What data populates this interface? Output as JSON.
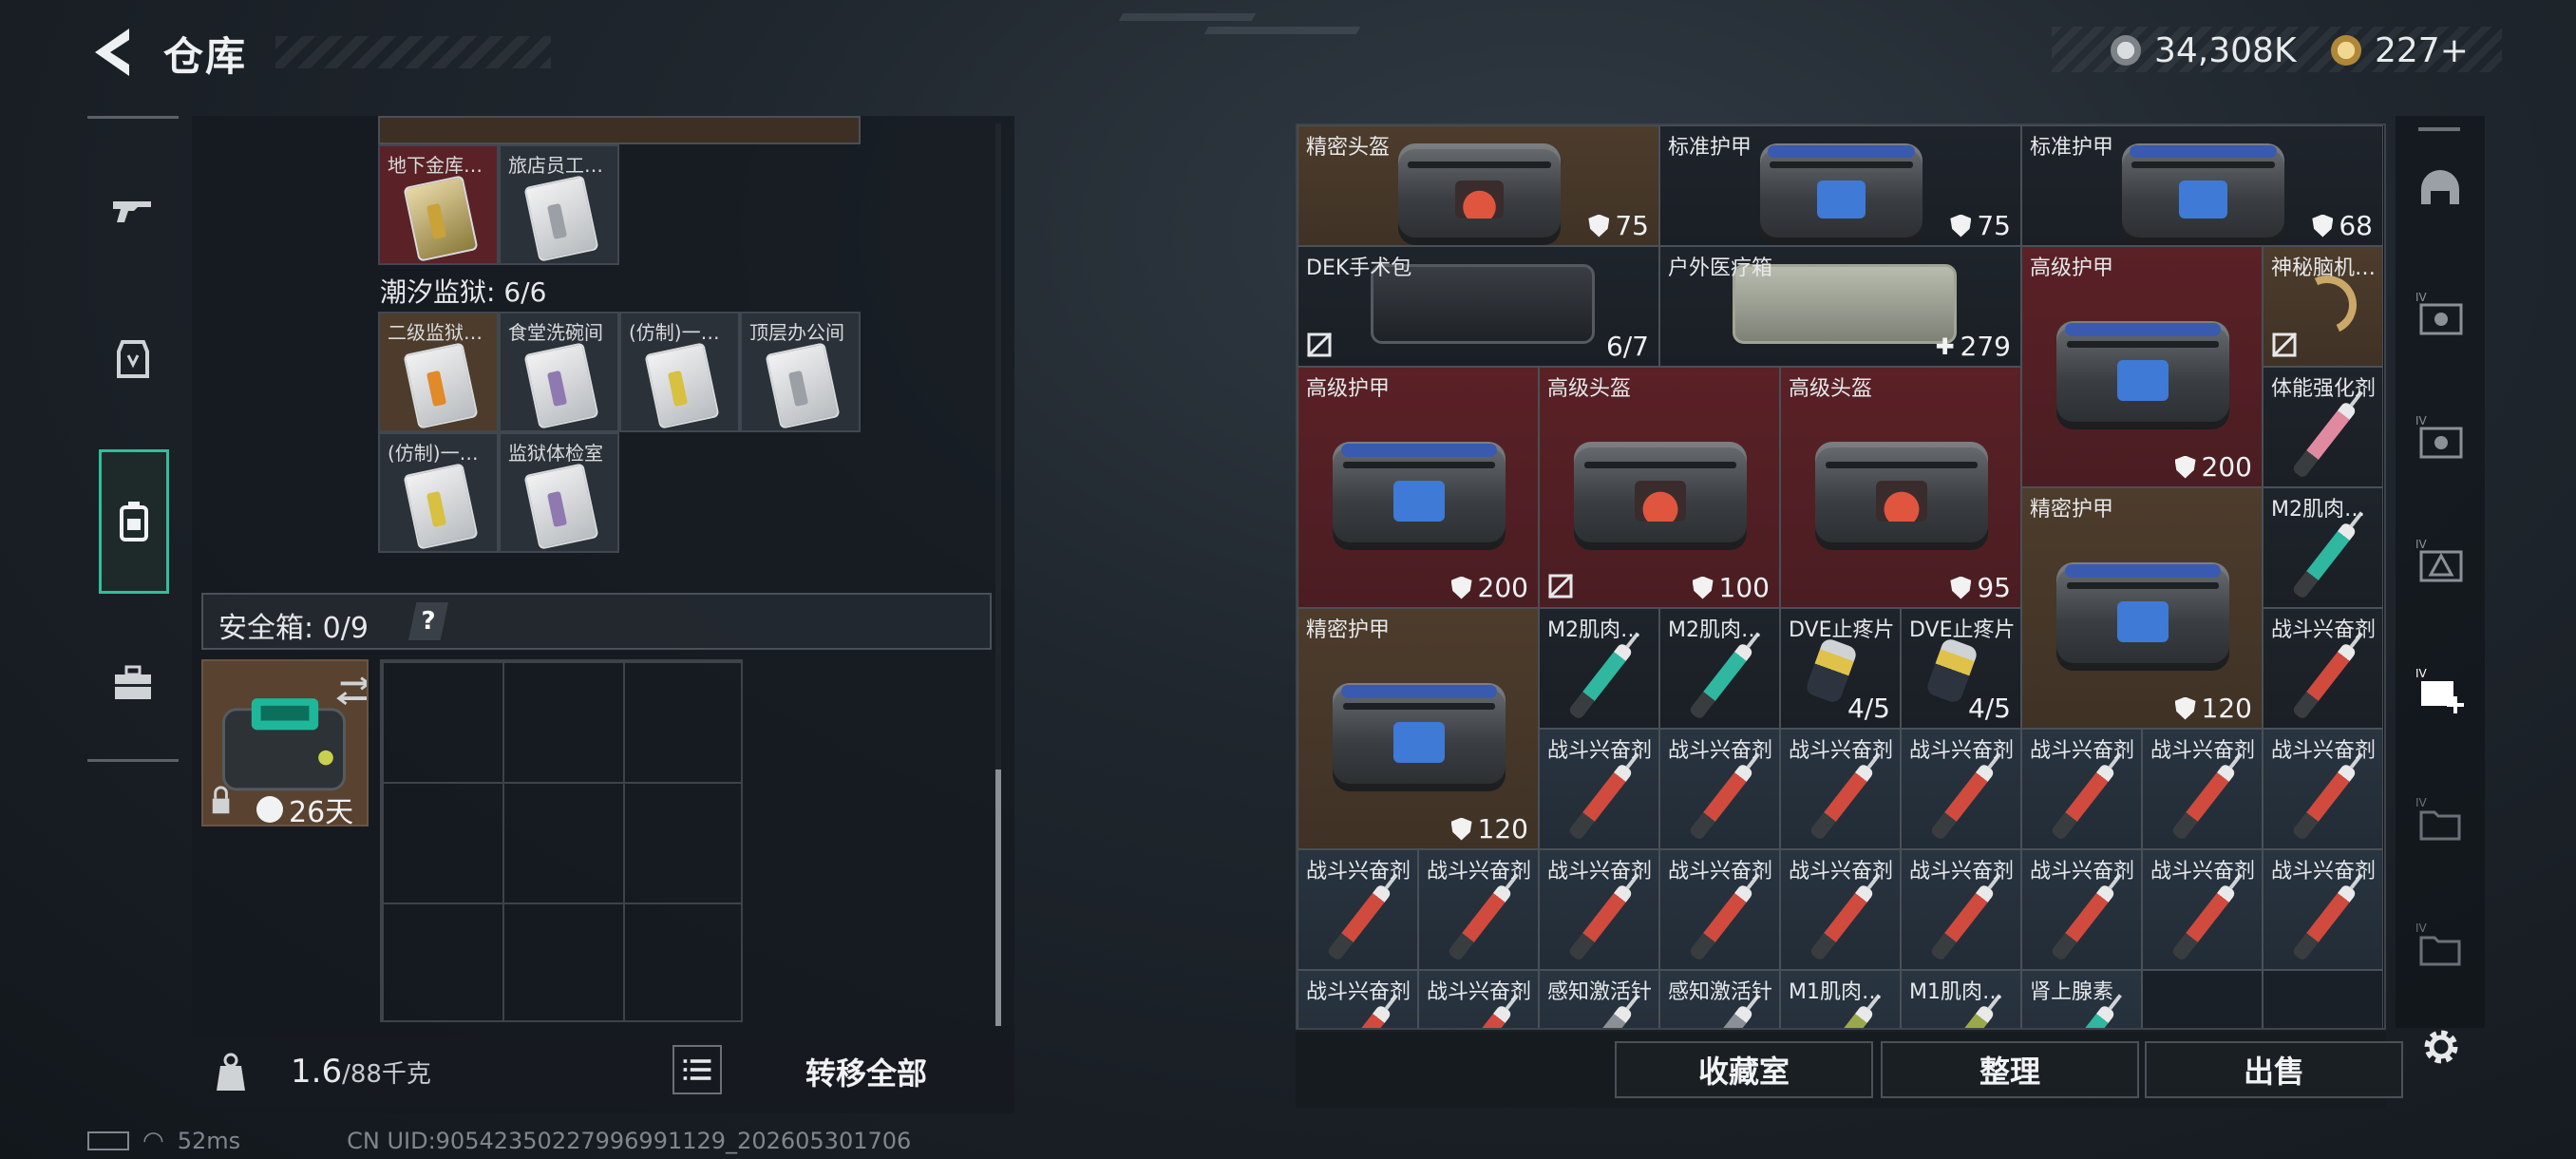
{
  "header": {
    "title": "仓库",
    "currency_1": "34,308K",
    "currency_2": "227+"
  },
  "left_tabs": [
    "gun-icon",
    "armor-icon",
    "backpack-icon",
    "toolbox-icon"
  ],
  "stash": {
    "top_items": [
      {
        "label": "地下金库…",
        "tone": "red",
        "key_color": "#c9a23a"
      },
      {
        "label": "旅店员工…",
        "tone": "dark",
        "key_color": "#9aa0a6"
      }
    ],
    "section_tidal": {
      "title": "潮汐监狱: 6/6"
    },
    "tidal_items": [
      {
        "label": "二级监狱…",
        "tone": "brown",
        "key_color": "#e08a2a"
      },
      {
        "label": "食堂洗碗间",
        "tone": "dark",
        "key_color": "#8e7ab0"
      },
      {
        "label": "(仿制)一…",
        "tone": "dark",
        "key_color": "#d8c040"
      },
      {
        "label": "顶层办公间",
        "tone": "dark",
        "key_color": "#9aa0a6"
      },
      {
        "label": "(仿制)一…",
        "tone": "dark",
        "key_color": "#d8c040"
      },
      {
        "label": "监狱体检室",
        "tone": "dark",
        "key_color": "#8e7ab0"
      }
    ],
    "safe_label": "安全箱: 0/9",
    "help": "?",
    "safe_box_timer": "26天",
    "weight_value": "1.6",
    "weight_unit": "/88千克",
    "transfer_all": "转移全部"
  },
  "status": {
    "ping": "52ms",
    "uid": "CN UID:9054235022799699112​9_202605301706"
  },
  "inventory": {
    "items": [
      {
        "name": "精密头盔",
        "tone": "brn",
        "kind": "bag-red",
        "value": "75",
        "vicon": "shield",
        "c": 0,
        "r": 0,
        "w": 3,
        "h": 1
      },
      {
        "name": "标准护甲",
        "tone": "dk",
        "kind": "bag-blue",
        "value": "75",
        "vicon": "shield",
        "c": 3,
        "r": 0,
        "w": 3,
        "h": 1
      },
      {
        "name": "标准护甲",
        "tone": "dk",
        "kind": "bag-blue",
        "value": "68",
        "vicon": "shield",
        "c": 6,
        "r": 0,
        "w": 3,
        "h": 1
      },
      {
        "name": "DEK手术包",
        "tone": "dk",
        "kind": "kit-dark",
        "value": "6/7",
        "vicon": "",
        "nobind": true,
        "c": 0,
        "r": 1,
        "w": 3,
        "h": 1
      },
      {
        "name": "户外医疗箱",
        "tone": "dk",
        "kind": "kit-light",
        "value": "279",
        "vicon": "plus",
        "c": 3,
        "r": 1,
        "w": 3,
        "h": 1
      },
      {
        "name": "高级护甲",
        "tone": "red",
        "kind": "bag-blue",
        "value": "200",
        "vicon": "shield",
        "c": 6,
        "r": 1,
        "w": 2,
        "h": 2
      },
      {
        "name": "神秘脑机…",
        "tone": "brn",
        "kind": "device",
        "value": "",
        "vicon": "",
        "nobind": true,
        "c": 8,
        "r": 1,
        "w": 1,
        "h": 1
      },
      {
        "name": "高级护甲",
        "tone": "red",
        "kind": "bag-blue",
        "value": "200",
        "vicon": "shield",
        "c": 0,
        "r": 2,
        "w": 2,
        "h": 2
      },
      {
        "name": "高级头盔",
        "tone": "red",
        "kind": "bag-red",
        "value": "100",
        "vicon": "shield",
        "nobind": true,
        "c": 2,
        "r": 2,
        "w": 2,
        "h": 2
      },
      {
        "name": "高级头盔",
        "tone": "red",
        "kind": "bag-red",
        "value": "95",
        "vicon": "shield",
        "c": 4,
        "r": 2,
        "w": 2,
        "h": 2
      },
      {
        "name": "体能强化剂",
        "tone": "dk",
        "kind": "syringe-pink",
        "value": "",
        "vicon": "",
        "c": 8,
        "r": 2,
        "w": 1,
        "h": 1
      },
      {
        "name": "精密护甲",
        "tone": "brn",
        "kind": "bag-blue",
        "value": "120",
        "vicon": "shield",
        "c": 6,
        "r": 3,
        "w": 2,
        "h": 2
      },
      {
        "name": "M2肌肉…",
        "tone": "dk",
        "kind": "syringe-teal",
        "value": "",
        "vicon": "",
        "c": 8,
        "r": 3,
        "w": 1,
        "h": 1
      },
      {
        "name": "精密护甲",
        "tone": "brn",
        "kind": "bag-blue",
        "value": "120",
        "vicon": "shield",
        "c": 0,
        "r": 4,
        "w": 2,
        "h": 2
      },
      {
        "name": "M2肌肉…",
        "tone": "dk",
        "kind": "syringe-teal",
        "value": "",
        "vicon": "",
        "c": 2,
        "r": 4,
        "w": 1,
        "h": 1
      },
      {
        "name": "M2肌肉…",
        "tone": "dk",
        "kind": "syringe-teal",
        "value": "",
        "vicon": "",
        "c": 3,
        "r": 4,
        "w": 1,
        "h": 1
      },
      {
        "name": "DVE止疼片",
        "tone": "dk",
        "kind": "pills",
        "value": "4/5",
        "vicon": "",
        "c": 4,
        "r": 4,
        "w": 1,
        "h": 1
      },
      {
        "name": "DVE止疼片",
        "tone": "dk",
        "kind": "pills",
        "value": "4/5",
        "vicon": "",
        "c": 5,
        "r": 4,
        "w": 1,
        "h": 1
      },
      {
        "name": "战斗兴奋剂",
        "tone": "dk",
        "kind": "syringe",
        "value": "",
        "vicon": "",
        "c": 8,
        "r": 4,
        "w": 1,
        "h": 1
      },
      {
        "name": "战斗兴奋剂",
        "tone": "blu",
        "kind": "syringe",
        "value": "",
        "vicon": "",
        "c": 2,
        "r": 5,
        "w": 1,
        "h": 1
      },
      {
        "name": "战斗兴奋剂",
        "tone": "blu",
        "kind": "syringe",
        "value": "",
        "vicon": "",
        "c": 3,
        "r": 5,
        "w": 1,
        "h": 1
      },
      {
        "name": "战斗兴奋剂",
        "tone": "blu",
        "kind": "syringe",
        "value": "",
        "vicon": "",
        "c": 4,
        "r": 5,
        "w": 1,
        "h": 1
      },
      {
        "name": "战斗兴奋剂",
        "tone": "blu",
        "kind": "syringe",
        "value": "",
        "vicon": "",
        "c": 5,
        "r": 5,
        "w": 1,
        "h": 1
      },
      {
        "name": "战斗兴奋剂",
        "tone": "blu",
        "kind": "syringe",
        "value": "",
        "vicon": "",
        "c": 6,
        "r": 5,
        "w": 1,
        "h": 1
      },
      {
        "name": "战斗兴奋剂",
        "tone": "blu",
        "kind": "syringe",
        "value": "",
        "vicon": "",
        "c": 7,
        "r": 5,
        "w": 1,
        "h": 1
      },
      {
        "name": "战斗兴奋剂",
        "tone": "blu",
        "kind": "syringe",
        "value": "",
        "vicon": "",
        "c": 8,
        "r": 5,
        "w": 1,
        "h": 1
      },
      {
        "name": "战斗兴奋剂",
        "tone": "blu",
        "kind": "syringe",
        "value": "",
        "vicon": "",
        "c": 0,
        "r": 6,
        "w": 1,
        "h": 1
      },
      {
        "name": "战斗兴奋剂",
        "tone": "blu",
        "kind": "syringe",
        "value": "",
        "vicon": "",
        "c": 1,
        "r": 6,
        "w": 1,
        "h": 1
      },
      {
        "name": "战斗兴奋剂",
        "tone": "blu",
        "kind": "syringe",
        "value": "",
        "vicon": "",
        "c": 2,
        "r": 6,
        "w": 1,
        "h": 1
      },
      {
        "name": "战斗兴奋剂",
        "tone": "blu",
        "kind": "syringe",
        "value": "",
        "vicon": "",
        "c": 3,
        "r": 6,
        "w": 1,
        "h": 1
      },
      {
        "name": "战斗兴奋剂",
        "tone": "blu",
        "kind": "syringe",
        "value": "",
        "vicon": "",
        "c": 4,
        "r": 6,
        "w": 1,
        "h": 1
      },
      {
        "name": "战斗兴奋剂",
        "tone": "blu",
        "kind": "syringe",
        "value": "",
        "vicon": "",
        "c": 5,
        "r": 6,
        "w": 1,
        "h": 1
      },
      {
        "name": "战斗兴奋剂",
        "tone": "blu",
        "kind": "syringe",
        "value": "",
        "vicon": "",
        "c": 6,
        "r": 6,
        "w": 1,
        "h": 1
      },
      {
        "name": "战斗兴奋剂",
        "tone": "blu",
        "kind": "syringe",
        "value": "",
        "vicon": "",
        "c": 7,
        "r": 6,
        "w": 1,
        "h": 1
      },
      {
        "name": "战斗兴奋剂",
        "tone": "blu",
        "kind": "syringe",
        "value": "",
        "vicon": "",
        "c": 8,
        "r": 6,
        "w": 1,
        "h": 1
      },
      {
        "name": "战斗兴奋剂",
        "tone": "blu",
        "kind": "syringe",
        "value": "",
        "vicon": "",
        "c": 0,
        "r": 7,
        "w": 1,
        "h": 1
      },
      {
        "name": "战斗兴奋剂",
        "tone": "blu",
        "kind": "syringe",
        "value": "",
        "vicon": "",
        "c": 1,
        "r": 7,
        "w": 1,
        "h": 1
      },
      {
        "name": "感知激活针",
        "tone": "blu",
        "kind": "syringe-gray",
        "value": "",
        "vicon": "",
        "c": 2,
        "r": 7,
        "w": 1,
        "h": 1
      },
      {
        "name": "感知激活针",
        "tone": "blu",
        "kind": "syringe-gray",
        "value": "",
        "vicon": "",
        "c": 3,
        "r": 7,
        "w": 1,
        "h": 1
      },
      {
        "name": "M1肌肉…",
        "tone": "blu",
        "kind": "syringe-olive",
        "value": "",
        "vicon": "",
        "c": 4,
        "r": 7,
        "w": 1,
        "h": 1
      },
      {
        "name": "M1肌肉…",
        "tone": "blu",
        "kind": "syringe-olive",
        "value": "",
        "vicon": "",
        "c": 5,
        "r": 7,
        "w": 1,
        "h": 1
      },
      {
        "name": "肾上腺素",
        "tone": "blu",
        "kind": "syringe-teal",
        "value": "",
        "vicon": "",
        "c": 6,
        "r": 7,
        "w": 1,
        "h": 1
      }
    ],
    "buttons": {
      "collection": "收藏室",
      "organize": "整理",
      "sell": "出售"
    }
  },
  "right_rail": {
    "selected_index": 4,
    "tabs": [
      "helmet-icon",
      "IV-storage-icon",
      "IV-storage-icon",
      "IV-alert-icon",
      "IV-add-icon",
      "IV-folder-icon",
      "IV-folder-icon"
    ]
  }
}
